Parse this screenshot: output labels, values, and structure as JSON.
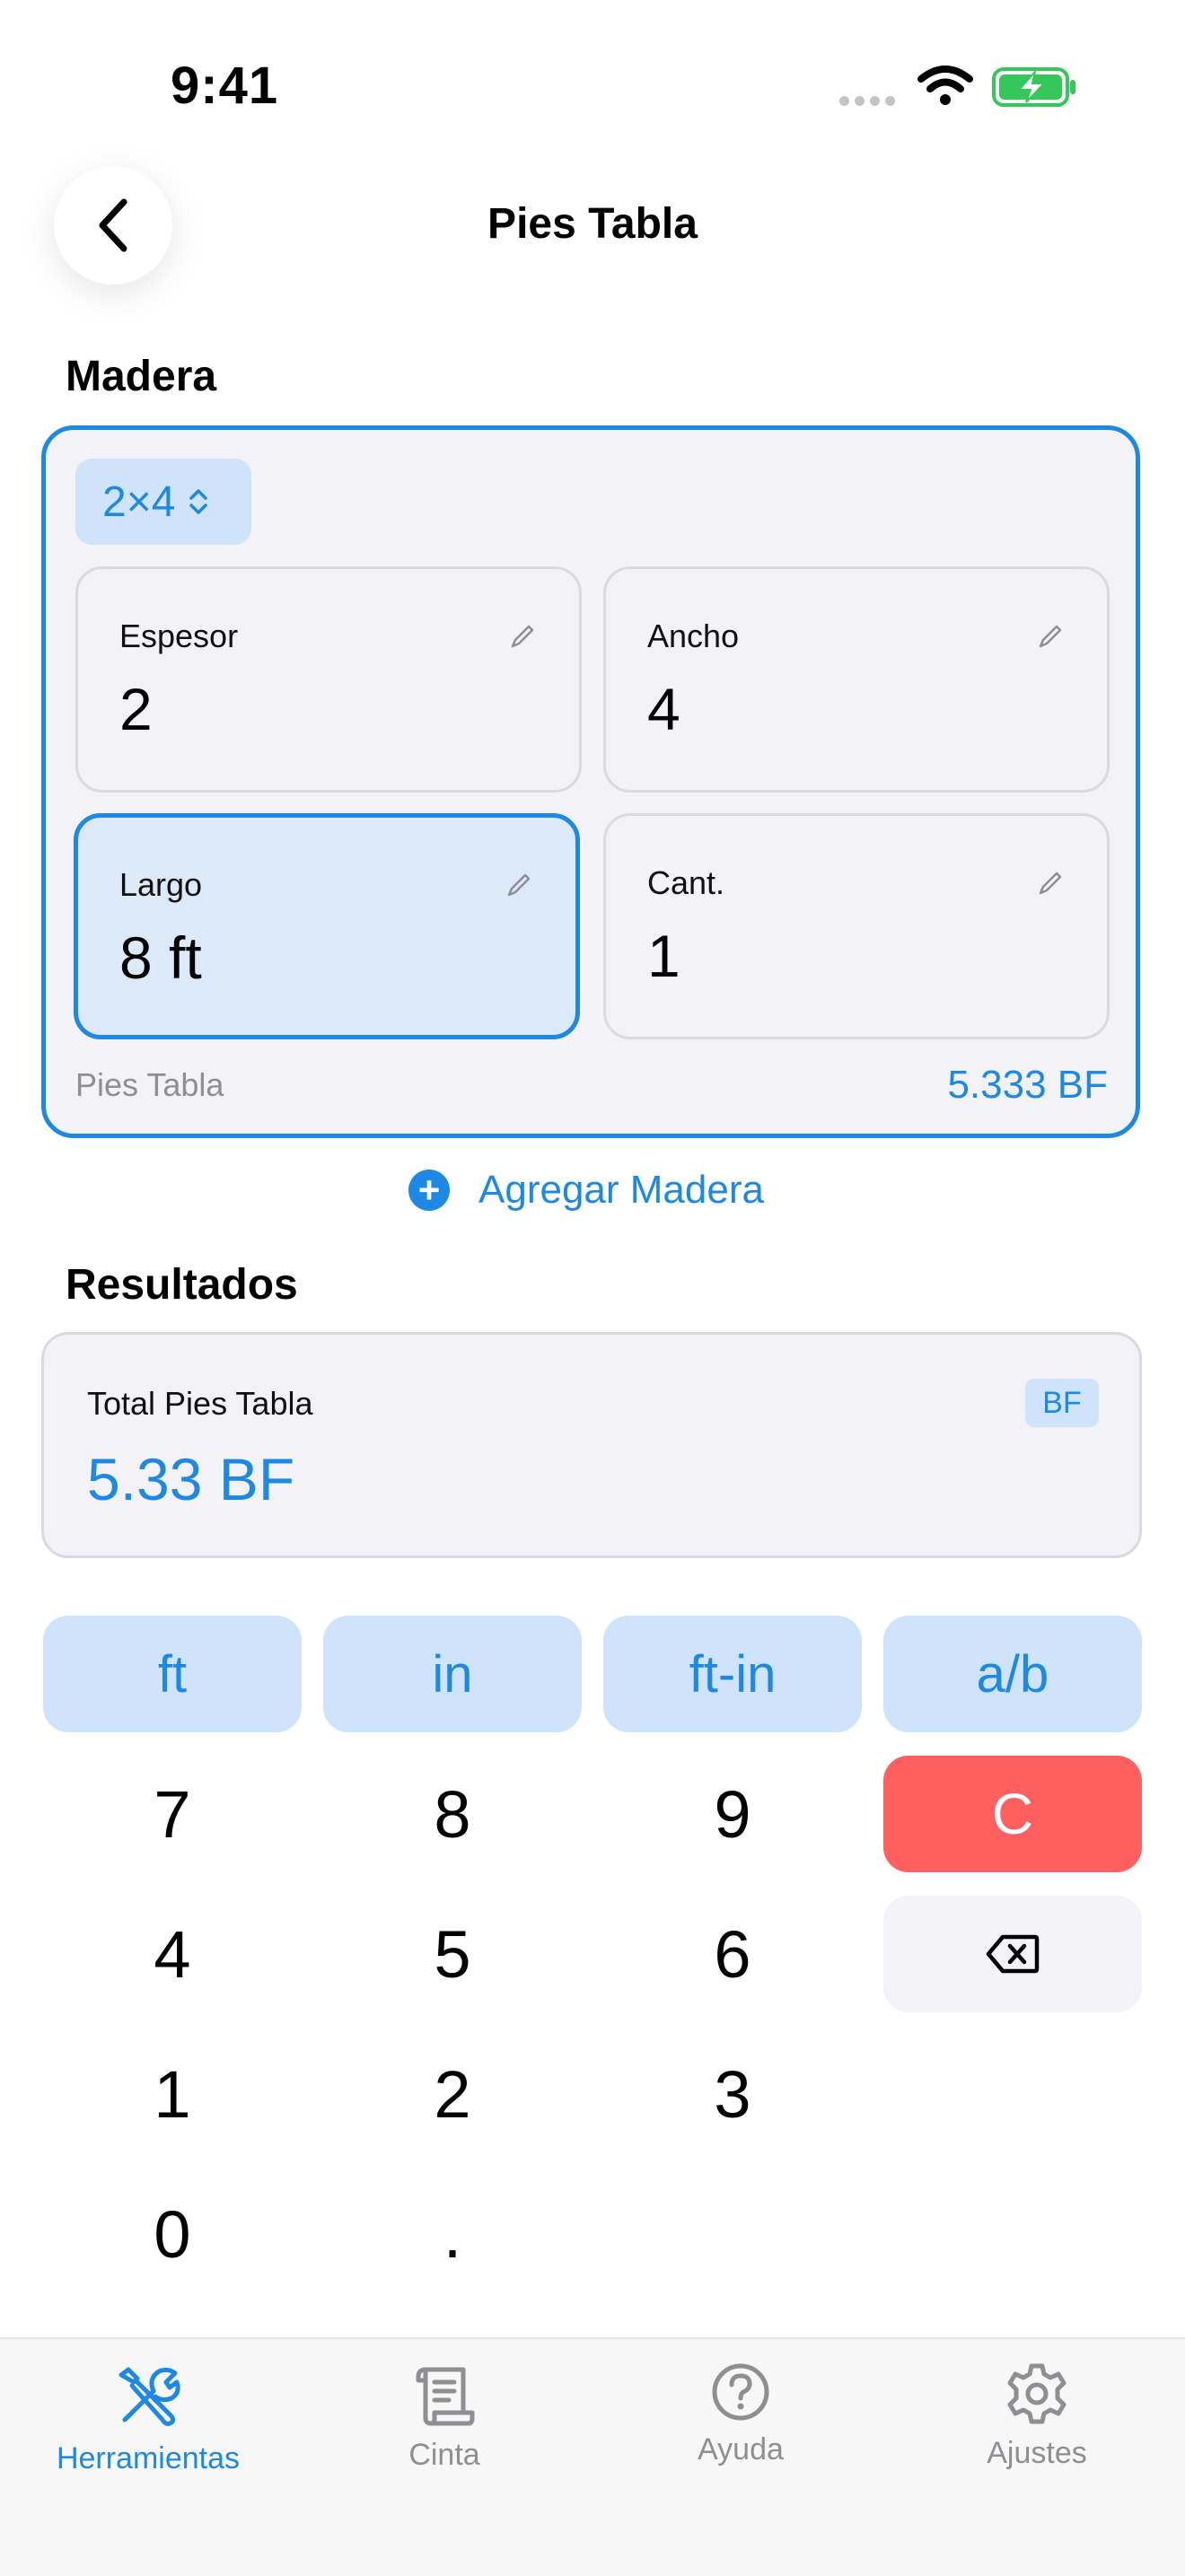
{
  "status": {
    "time": "9:41"
  },
  "nav": {
    "title": "Pies Tabla"
  },
  "lumber_section": {
    "title": "Madera",
    "preset": "2×4",
    "fields": [
      {
        "label": "Espesor",
        "value": "2"
      },
      {
        "label": "Ancho",
        "value": "4"
      },
      {
        "label": "Largo",
        "value": "8 ft",
        "active": true
      },
      {
        "label": "Cant.",
        "value": "1"
      }
    ],
    "board_feet_label": "Pies Tabla",
    "board_feet_value": "5.333 BF"
  },
  "add_lumber_label": "Agregar Madera",
  "results": {
    "title": "Resultados",
    "total_label": "Total Pies Tabla",
    "total_value": "5.33 BF",
    "badge": "BF"
  },
  "keypad": {
    "units": [
      "ft",
      "in",
      "ft-in",
      "a/b"
    ],
    "rows": [
      [
        "7",
        "8",
        "9"
      ],
      [
        "4",
        "5",
        "6"
      ],
      [
        "1",
        "2",
        "3"
      ],
      [
        "0",
        "."
      ]
    ],
    "clear": "C"
  },
  "tabs": [
    {
      "label": "Herramientas",
      "icon": "tools-icon",
      "active": true
    },
    {
      "label": "Cinta",
      "icon": "scroll-icon"
    },
    {
      "label": "Ayuda",
      "icon": "help-icon"
    },
    {
      "label": "Ajustes",
      "icon": "gear-icon"
    }
  ],
  "colors": {
    "accent": "#1e88e5",
    "clear": "#fe5f5f",
    "chip": "#cfe4fb",
    "card": "#f2f2f7"
  }
}
